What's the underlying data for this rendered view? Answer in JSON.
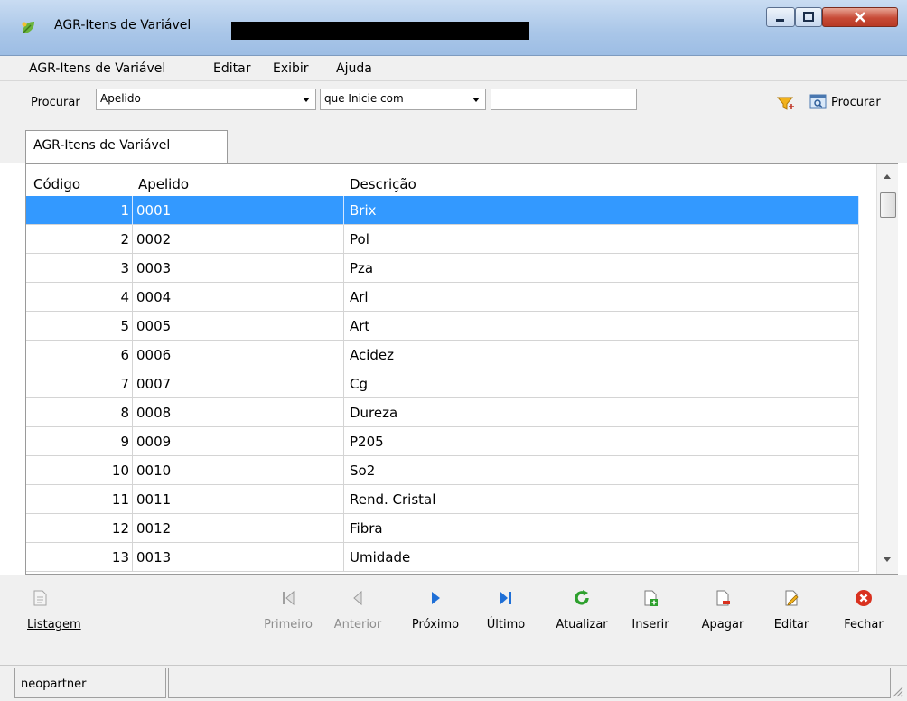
{
  "window": {
    "title": "AGR-Itens de Variável"
  },
  "menu": {
    "items": [
      "AGR-Itens de Variável",
      "Editar",
      "Exibir",
      "Ajuda"
    ]
  },
  "search": {
    "label": "Procurar",
    "field_value": "Apelido",
    "operator_value": "que Inicie com",
    "input_value": "",
    "button_label": "Procurar"
  },
  "tab": {
    "label": "AGR-Itens de Variável"
  },
  "grid": {
    "columns": [
      "Código",
      "Apelido",
      "Descrição"
    ],
    "rows": [
      {
        "codigo": "1",
        "apelido": "0001",
        "descricao": "Brix"
      },
      {
        "codigo": "2",
        "apelido": "0002",
        "descricao": "Pol"
      },
      {
        "codigo": "3",
        "apelido": "0003",
        "descricao": "Pza"
      },
      {
        "codigo": "4",
        "apelido": "0004",
        "descricao": "Arl"
      },
      {
        "codigo": "5",
        "apelido": "0005",
        "descricao": "Art"
      },
      {
        "codigo": "6",
        "apelido": "0006",
        "descricao": "Acidez"
      },
      {
        "codigo": "7",
        "apelido": "0007",
        "descricao": "Cg"
      },
      {
        "codigo": "8",
        "apelido": "0008",
        "descricao": "Dureza"
      },
      {
        "codigo": "9",
        "apelido": "0009",
        "descricao": "P205"
      },
      {
        "codigo": "10",
        "apelido": "0010",
        "descricao": "So2"
      },
      {
        "codigo": "11",
        "apelido": "0011",
        "descricao": "Rend. Cristal"
      },
      {
        "codigo": "12",
        "apelido": "0012",
        "descricao": "Fibra"
      },
      {
        "codigo": "13",
        "apelido": "0013",
        "descricao": "Umidade"
      }
    ],
    "selected_row": 0
  },
  "toolbar": {
    "listagem": "Listagem",
    "primeiro": "Primeiro",
    "anterior": "Anterior",
    "proximo": "Próximo",
    "ultimo": "Último",
    "atualizar": "Atualizar",
    "inserir": "Inserir",
    "apagar": "Apagar",
    "editar": "Editar",
    "fechar": "Fechar"
  },
  "status": {
    "user": "neopartner"
  },
  "colors": {
    "selection": "#3399ff",
    "nav_blue": "#1f6fd6",
    "refresh_green": "#2ea02e",
    "close_red": "#d9311f"
  }
}
